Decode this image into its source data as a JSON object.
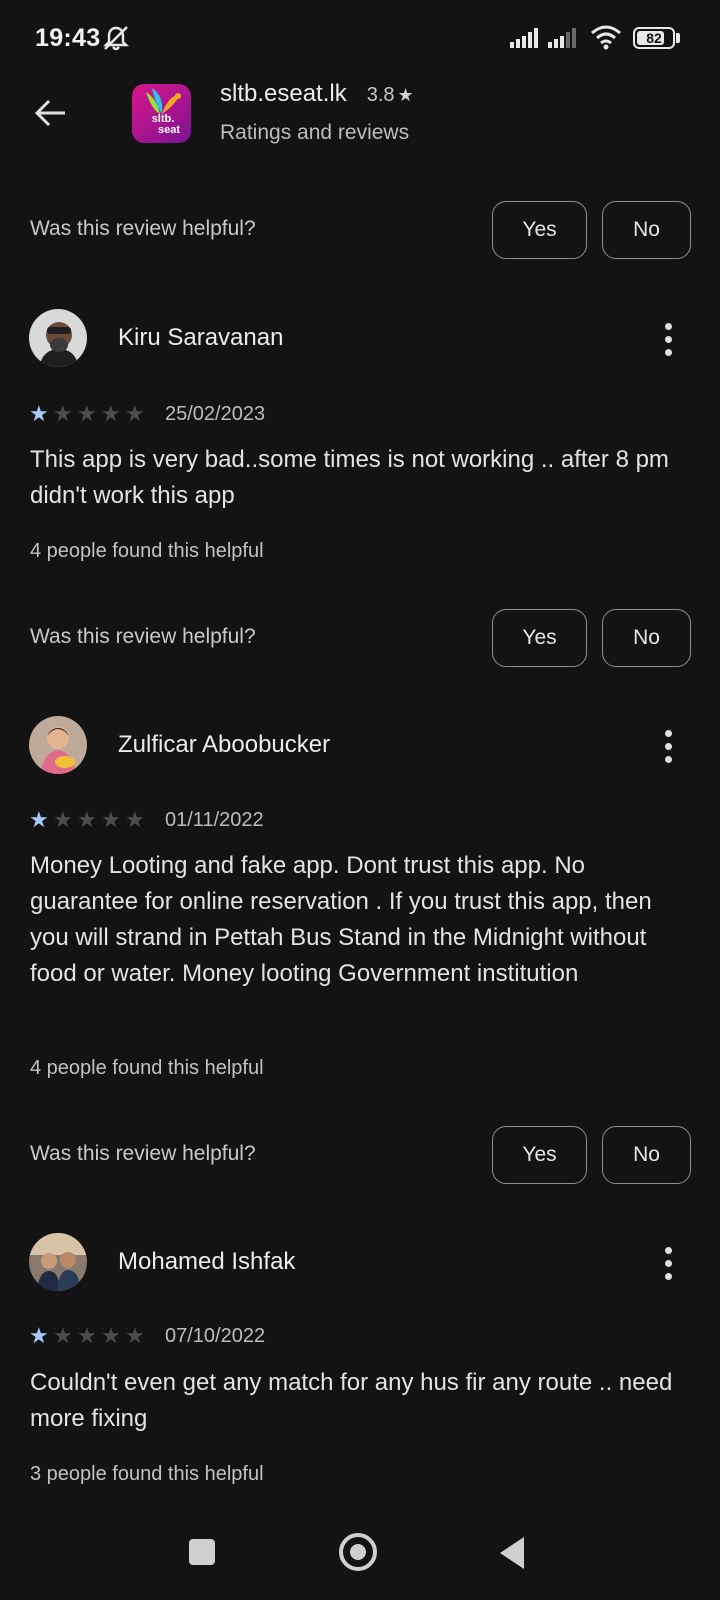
{
  "status_bar": {
    "time": "19:43",
    "battery": "82",
    "battery_level": 0.82
  },
  "header": {
    "app_name": "sltb.eseat.lk",
    "rating": "3.8",
    "rating_star": "★",
    "subtitle": "Ratings and reviews",
    "app_icon_text_1": "sltb.",
    "app_icon_text_2": "seat"
  },
  "helpful_prompt": {
    "question": "Was this review helpful?",
    "yes_label": "Yes",
    "no_label": "No"
  },
  "reviews": [
    {
      "name": "Kiru Saravanan",
      "stars": 1,
      "date": "25/02/2023",
      "body": "This app is very bad..some times is not working .. after 8 pm didn't work this app",
      "helpful": "4 people found this helpful"
    },
    {
      "name": "Zulficar Aboobucker",
      "stars": 1,
      "date": "01/11/2022",
      "body": "Money Looting and fake app. Dont trust this app. No guarantee for online reservation . If you trust this app, then you will strand in Pettah Bus Stand in the Midnight without food or water. Money looting Government institution",
      "helpful": "4 people found this helpful"
    },
    {
      "name": "Mohamed Ishfak",
      "stars": 1,
      "date": "07/10/2022",
      "body": "Couldn't even get any match for any hus fir any route .. need more fixing",
      "helpful": "3 people found this helpful"
    }
  ],
  "colors": {
    "background": "#131313",
    "star_filled": "#a8c7fa",
    "star_empty": "#4a4d50"
  }
}
